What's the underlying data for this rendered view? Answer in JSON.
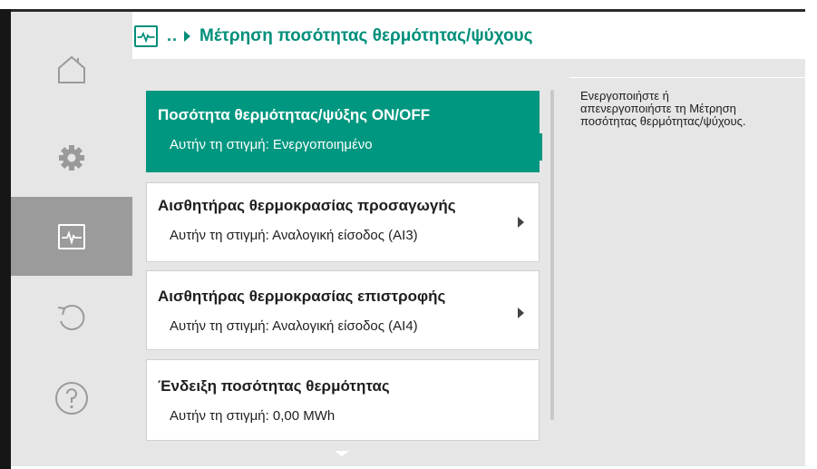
{
  "header": {
    "icon": "monitor-icon",
    "breadcrumb_dots": "..",
    "breadcrumb_arrow": "chevron-right-icon",
    "title": "Μέτρηση ποσότητας θερμότητας/ψύχους"
  },
  "sidebar": {
    "items": [
      {
        "icon": "home-icon",
        "active": false
      },
      {
        "icon": "gear-icon",
        "active": false
      },
      {
        "icon": "monitor-icon",
        "active": true
      },
      {
        "icon": "undo-icon",
        "active": false
      },
      {
        "icon": "help-icon",
        "active": false
      }
    ]
  },
  "menu": {
    "items": [
      {
        "title": "Ποσότητα θερμότητας/ψύξης ON/OFF",
        "subtitle": "Αυτήν τη στιγμή: Ενεργοποιημένο",
        "selected": true,
        "has_submenu": false
      },
      {
        "title": "Αισθητήρας θερμοκρασίας προσαγωγής",
        "subtitle": "Αυτήν τη στιγμή: Αναλογική είσοδος (AI3)",
        "selected": false,
        "has_submenu": true
      },
      {
        "title": "Αισθητήρας θερμοκρασίας επιστροφής",
        "subtitle": "Αυτήν τη στιγμή: Αναλογική είσοδος (AI4)",
        "selected": false,
        "has_submenu": true
      },
      {
        "title": "Ένδειξη ποσότητας θερμότητας",
        "subtitle": "Αυτήν τη στιγμή: 0,00 MWh",
        "selected": false,
        "has_submenu": false
      }
    ]
  },
  "help": {
    "text": "Ενεργοποιήστε ή απενεργοποιήστε τη Μέτρηση ποσότητας θερμότητας/ψύχους."
  },
  "colors": {
    "accent": "#009780",
    "sidebar_bg": "#e6e6e6",
    "sidebar_active": "#9b9b9b",
    "panel_bg": "#e6e6e6",
    "text": "#1e1e1e"
  }
}
